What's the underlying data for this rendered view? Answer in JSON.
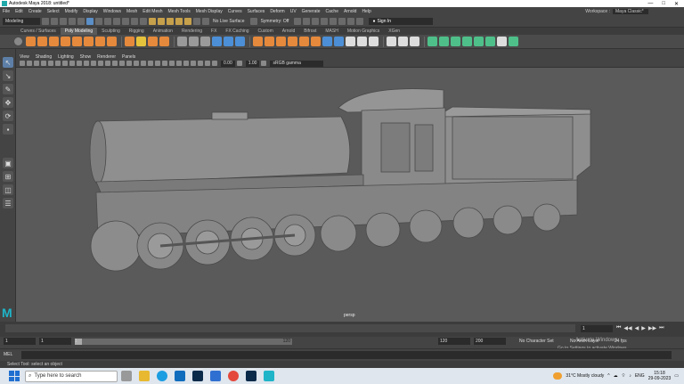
{
  "window": {
    "title": "Autodesk Maya 2018: untitled*",
    "controls": [
      "—",
      "□",
      "✕"
    ]
  },
  "menubar": {
    "items": [
      "File",
      "Edit",
      "Create",
      "Select",
      "Modify",
      "Display",
      "Windows",
      "Mesh",
      "Edit Mesh",
      "Mesh Tools",
      "Mesh Display",
      "Curves",
      "Surfaces",
      "Deform",
      "UV",
      "Generate",
      "Cache",
      "Arnold",
      "Help"
    ],
    "workspace_label": "Workspace :",
    "workspace_value": "Maya Classic*"
  },
  "statusline": {
    "mode": "Modeling",
    "live_surface": "No Live Surface",
    "symmetry": "Symmetry: Off",
    "sign_in": "Sign In"
  },
  "shelf_tabs": {
    "items": [
      "Curves / Surfaces",
      "Poly Modeling",
      "Sculpting",
      "Rigging",
      "Animation",
      "Rendering",
      "FX",
      "FX Caching",
      "Custom",
      "Arnold",
      "Bifrost",
      "MASH",
      "Motion Graphics",
      "XGen"
    ],
    "active": "Poly Modeling"
  },
  "panel": {
    "menu": [
      "View",
      "Shading",
      "Lighting",
      "Show",
      "Renderer",
      "Panels"
    ],
    "field_a": "0.00",
    "field_b": "1.00",
    "color_space": "sRGB gamma",
    "camera_label": "persp"
  },
  "timeline": {
    "current_frame": "1",
    "playback_icons": [
      "⏮",
      "◀◀",
      "◀",
      "▶",
      "▶▶",
      "⏭"
    ]
  },
  "range": {
    "start": "1",
    "start_inner": "1",
    "slider_start": "1",
    "slider_end": "120",
    "end_inner": "120",
    "end": "200",
    "character_set": "No Character Set",
    "anim_layer": "No Anim Layer",
    "fps": "24 fps"
  },
  "watermark": {
    "line1": "Activate Windows",
    "line2": "Go to Settings to activate Windows."
  },
  "cmdline": {
    "lang": "MEL"
  },
  "helpline": {
    "text": "Select Tool: select an object"
  },
  "taskbar": {
    "search_placeholder": "Type here to search",
    "weather": "31°C  Mostly cloudy",
    "lang": "ENG",
    "time": "15:18",
    "date": "29-09-2023"
  },
  "colors": {
    "viewport_bg": "#5a5a5a",
    "model_fill": "#8c8c8c",
    "maya_teal": "#1fb4c8"
  }
}
